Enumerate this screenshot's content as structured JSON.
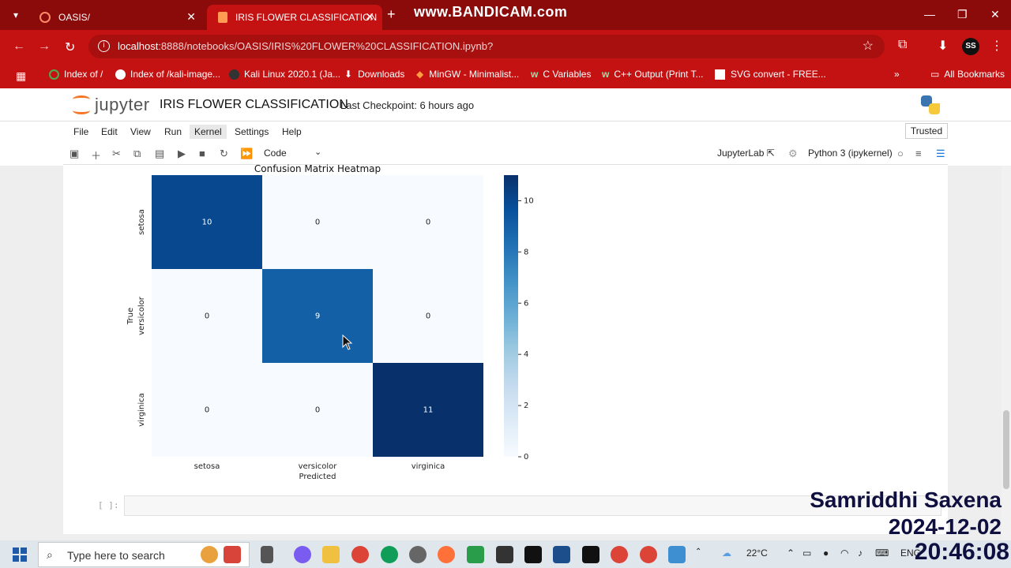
{
  "browser": {
    "tabs": [
      {
        "label": "OASIS/",
        "active": false
      },
      {
        "label": "IRIS FLOWER CLASSIFICATION",
        "active": true
      }
    ],
    "recorder_banner": "www.BANDICAM.com",
    "url": {
      "host": "localhost",
      "path": ":8888/notebooks/OASIS/IRIS%20FLOWER%20CLASSIFICATION.ipynb?"
    },
    "profile_initials": "SS",
    "bookmarks": [
      {
        "label": "Index of /",
        "icon": "circle-icon",
        "color": "#4caf50"
      },
      {
        "label": "Index of /kali-image...",
        "icon": "globe-icon",
        "color": "#ffffff"
      },
      {
        "label": "Kali Linux 2020.1 (Ja...",
        "icon": "dark-circle-icon",
        "color": "#333333"
      },
      {
        "label": "Downloads",
        "icon": "download-icon",
        "color": "#ffffff"
      },
      {
        "label": "MinGW - Minimalist...",
        "icon": "diamond-icon",
        "color": "#ff9e40"
      },
      {
        "label": "C Variables",
        "icon": "w3-icon",
        "color": "#04aa6d"
      },
      {
        "label": "C++ Output (Print T...",
        "icon": "w3-icon",
        "color": "#04aa6d"
      },
      {
        "label": "SVG convert - FREE...",
        "icon": "white-square-icon",
        "color": "#ffffff"
      }
    ],
    "all_bookmarks": "All Bookmarks"
  },
  "jupyter": {
    "logo_text": "jupyter",
    "notebook_title": "IRIS FLOWER CLASSIFICATION",
    "checkpoint": "Last Checkpoint: 6 hours ago",
    "menu": [
      "File",
      "Edit",
      "View",
      "Run",
      "Kernel",
      "Settings",
      "Help"
    ],
    "active_menu": "Kernel",
    "trusted": "Trusted",
    "cell_type": "Code",
    "jupyterlab_label": "JupyterLab",
    "kernel_name": "Python 3 (ipykernel)",
    "empty_prompt": "[ ]:"
  },
  "chart_data": {
    "type": "heatmap",
    "title": "Confusion Matrix Heatmap",
    "xlabel": "Predicted",
    "ylabel": "True",
    "x_categories": [
      "setosa",
      "versicolor",
      "virginica"
    ],
    "y_categories": [
      "setosa",
      "versicolor",
      "virginica"
    ],
    "values": [
      [
        10,
        0,
        0
      ],
      [
        0,
        9,
        0
      ],
      [
        0,
        0,
        11
      ]
    ],
    "colorbar_ticks": [
      0,
      2,
      4,
      6,
      8,
      10
    ],
    "vmin": 0,
    "vmax": 11,
    "colormap": "Blues"
  },
  "taskbar": {
    "search_placeholder": "Type here to search",
    "weather": "22°C",
    "language": "ENG"
  },
  "overlay": {
    "name": "Samriddhi Saxena",
    "date": "2024-12-02",
    "time": "20:46:08"
  }
}
